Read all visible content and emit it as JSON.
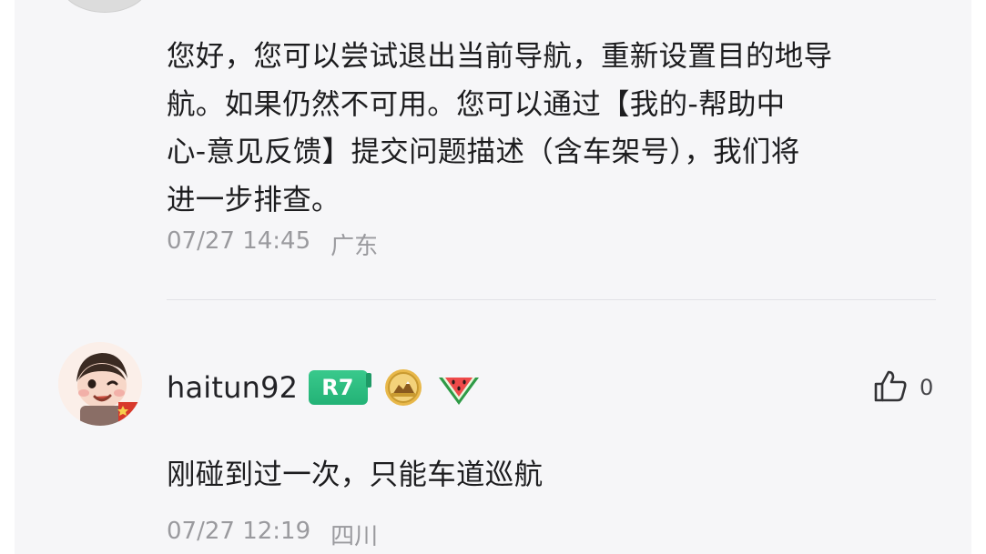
{
  "reply": {
    "lines": [
      "您好，您可以尝试退出当前导航，重新设置目的地导",
      "航。如果仍然不可用。您可以通过【我的-帮助中",
      "心-意见反馈】提交问题描述（含车架号），我们将",
      "进一步排查。"
    ],
    "date": "07/27 14:45",
    "location": "广东"
  },
  "comment": {
    "username": "haitun92",
    "level": "R7",
    "likes": "0",
    "text": "刚碰到过一次，只能车道巡航",
    "date": "07/27 12:19",
    "location": "四川"
  },
  "colors": {
    "background": "#f6f6f8",
    "text": "#1d1d1f",
    "meta": "#9a9a9e",
    "level_badge": "#2cbb80"
  },
  "icons": [
    "user-avatar-icon",
    "medal-icon",
    "watermelon-icon",
    "thumbs-up-icon"
  ]
}
